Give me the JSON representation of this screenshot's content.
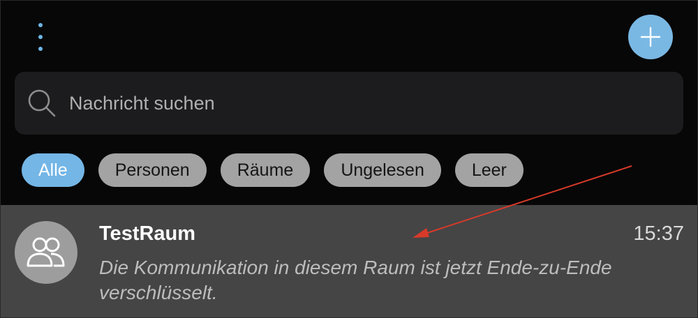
{
  "search": {
    "placeholder": "Nachricht suchen",
    "icon": "search-icon"
  },
  "header": {
    "menu_icon": "more-vertical-icon",
    "add_icon": "plus-icon"
  },
  "filters": [
    {
      "label": "Alle",
      "active": true
    },
    {
      "label": "Personen",
      "active": false
    },
    {
      "label": "Räume",
      "active": false
    },
    {
      "label": "Ungelesen",
      "active": false
    },
    {
      "label": "Leer",
      "active": false
    }
  ],
  "rooms": [
    {
      "name": "TestRaum",
      "time": "15:37",
      "preview": "Die Kommunikation in diesem Raum ist jetzt Ende-zu-Ende verschlüsselt.",
      "avatar_icon": "people-icon"
    }
  ],
  "colors": {
    "accent": "#74b6e6",
    "background": "#070707",
    "row_background": "#454545",
    "annotation_arrow": "#d83a2a"
  }
}
